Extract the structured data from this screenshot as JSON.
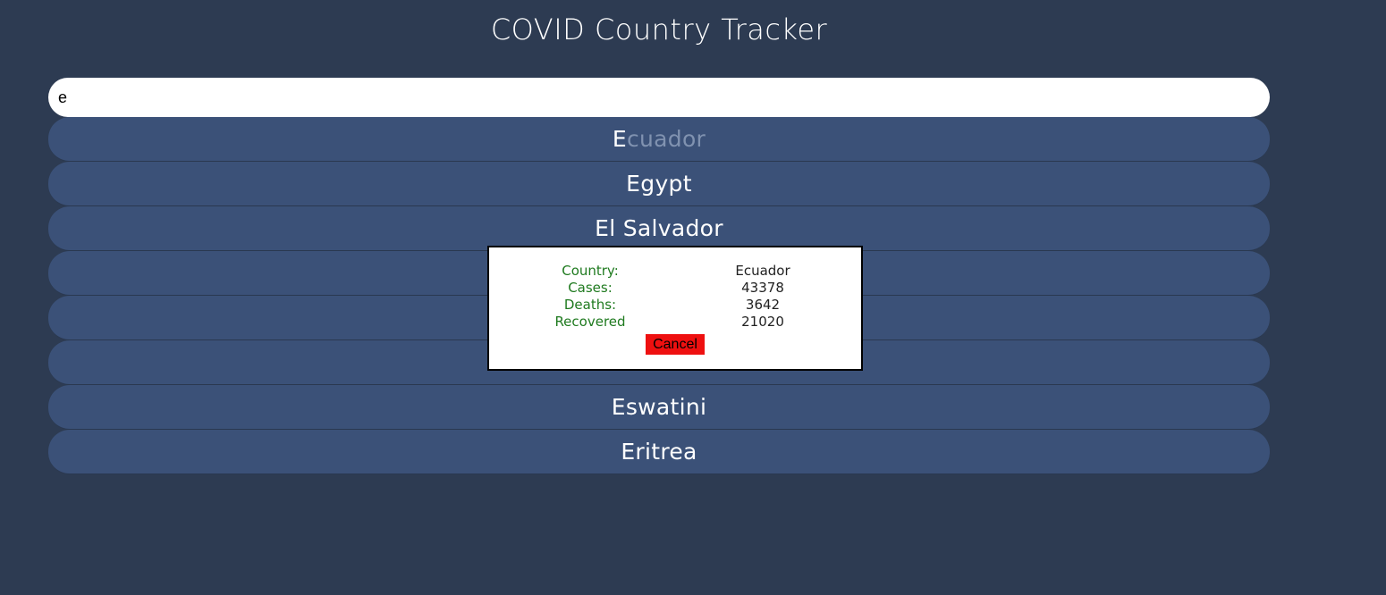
{
  "page": {
    "title": "COVID Country Tracker"
  },
  "search": {
    "value": "e",
    "placeholder": ""
  },
  "countries": [
    {
      "match": "E",
      "rest": "cuador",
      "hovered": true
    },
    {
      "match": "E",
      "rest": "gypt",
      "hovered": false
    },
    {
      "match": "E",
      "rest": "l Salvador",
      "hovered": false
    },
    {
      "match": "",
      "rest": "",
      "hovered": false
    },
    {
      "match": "",
      "rest": "",
      "hovered": false
    },
    {
      "match": "",
      "rest": "",
      "hovered": false
    },
    {
      "match": "E",
      "rest": "swatini",
      "hovered": false
    },
    {
      "match": "E",
      "rest": "ritrea",
      "hovered": false
    }
  ],
  "modal": {
    "rows": [
      {
        "label": "Country:",
        "value": "Ecuador"
      },
      {
        "label": "Cases:",
        "value": "43378"
      },
      {
        "label": "Deaths:",
        "value": "3642"
      },
      {
        "label": "Recovered",
        "value": "21020"
      }
    ],
    "cancel_label": "Cancel"
  },
  "colors": {
    "background": "#2d3b52",
    "row": "#3b5178",
    "label_green": "#1f7a1f",
    "cancel_red": "#ee1010"
  }
}
